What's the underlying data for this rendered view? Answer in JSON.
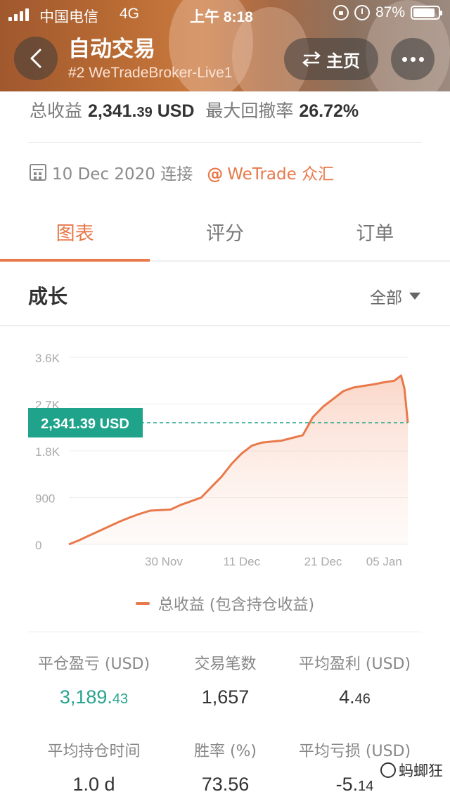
{
  "status_bar": {
    "carrier": "中国电信",
    "network": "4G",
    "time": "上午 8:18",
    "battery": "87%",
    "battery_level": 0.87
  },
  "header": {
    "title": "自动交易",
    "subtitle": "#2 WeTradeBroker-Live1",
    "home_label": "主页"
  },
  "summary": {
    "total_profit_label": "总收益",
    "total_profit_int": "2,341.",
    "total_profit_dec": "39",
    "total_profit_unit": "USD",
    "max_drawdown_label": "最大回撤率",
    "max_drawdown_value": "26.72%"
  },
  "connection": {
    "date": "10 Dec 2020 连接",
    "broker_at": "@",
    "broker": "WeTrade 众汇"
  },
  "tabs": [
    {
      "label": "图表",
      "active": true
    },
    {
      "label": "评分",
      "active": false
    },
    {
      "label": "订单",
      "active": false
    }
  ],
  "section": {
    "title": "成长",
    "filter": "全部"
  },
  "chart_data": {
    "type": "area",
    "yticks": [
      "3.6K",
      "2.7K",
      "1.8K",
      "900",
      "0"
    ],
    "ytick_values": [
      3600,
      2700,
      1800,
      900,
      0
    ],
    "xticks": [
      "30 Nov",
      "11 Dec",
      "21 Dec",
      "05 Jan"
    ],
    "xtick_positions": [
      0.28,
      0.51,
      0.75,
      0.93
    ],
    "ylim": [
      0,
      3600
    ],
    "current_value_label": "2,341.39 USD",
    "current_value": 2341.39,
    "series": [
      {
        "name": "总收益 (包含持仓收益)",
        "color": "#e8794a",
        "x": [
          0.0,
          0.03,
          0.06,
          0.09,
          0.12,
          0.15,
          0.18,
          0.21,
          0.24,
          0.27,
          0.3,
          0.33,
          0.36,
          0.39,
          0.42,
          0.45,
          0.48,
          0.51,
          0.54,
          0.57,
          0.6,
          0.63,
          0.66,
          0.69,
          0.72,
          0.75,
          0.76,
          0.78,
          0.81,
          0.84,
          0.87,
          0.9,
          0.93,
          0.96,
          0.98,
          0.99,
          1.0
        ],
        "values": [
          0,
          80,
          170,
          260,
          350,
          440,
          520,
          590,
          650,
          660,
          670,
          760,
          830,
          900,
          1100,
          1300,
          1550,
          1750,
          1900,
          1960,
          1980,
          2000,
          2050,
          2100,
          2450,
          2650,
          2700,
          2800,
          2950,
          3020,
          3050,
          3080,
          3120,
          3150,
          3250,
          3000,
          2341
        ]
      }
    ]
  },
  "legend": {
    "label": "总收益 (包含持仓收益)"
  },
  "stats": [
    {
      "label": "平仓盈亏 (USD)",
      "int": "3,189.",
      "dec": "43",
      "green": true
    },
    {
      "label": "交易笔数",
      "int": "1,657",
      "dec": "",
      "green": false
    },
    {
      "label": "平均盈利 (USD)",
      "int": "4.",
      "dec": "46",
      "green": false
    },
    {
      "label": "平均持仓时间",
      "int": "1.0 d",
      "dec": "",
      "green": false
    },
    {
      "label": "胜率 (%)",
      "int": "73.56",
      "dec": "",
      "green": false
    },
    {
      "label": "平均亏损 (USD)",
      "int": "-5.",
      "dec": "14",
      "green": false
    }
  ],
  "watermark": "蚂蝍狂",
  "colors": {
    "accent": "#e8794a",
    "green": "#26a48e",
    "dashed_line": "#1fa38a"
  }
}
